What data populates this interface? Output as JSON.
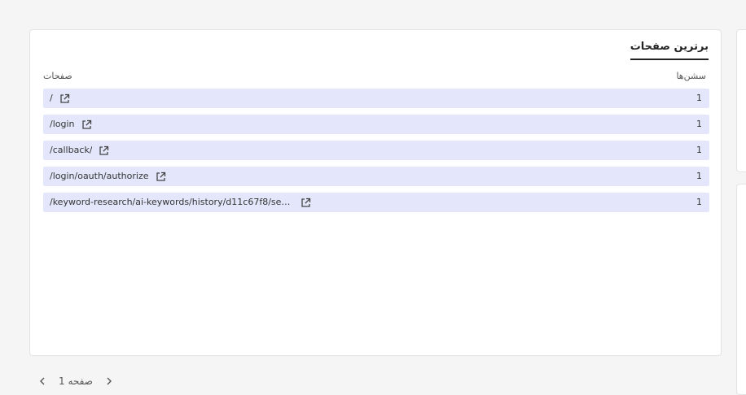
{
  "panel": {
    "title": "برترین صفحات",
    "col_pages": "صفحات",
    "col_sessions": "سشن‌ها"
  },
  "rows": [
    {
      "path": "/",
      "sessions": "1"
    },
    {
      "path": "/login",
      "sessions": "1"
    },
    {
      "path": "/callback/",
      "sessions": "1"
    },
    {
      "path": "/login/oauth/authorize",
      "sessions": "1"
    },
    {
      "path": "/keyword-research/ai-keywords/history/d11c67f8/seo...",
      "sessions": "1"
    }
  ],
  "pagination": {
    "label": "صفحه 1",
    "prev_icon": "chevron-left-icon",
    "next_icon": "chevron-right-icon"
  },
  "icons": {
    "row_link": "external-link-icon"
  },
  "colors": {
    "row_bg": "#e4e7fb",
    "card_bg": "#ffffff",
    "page_bg": "#f5f5f5"
  }
}
